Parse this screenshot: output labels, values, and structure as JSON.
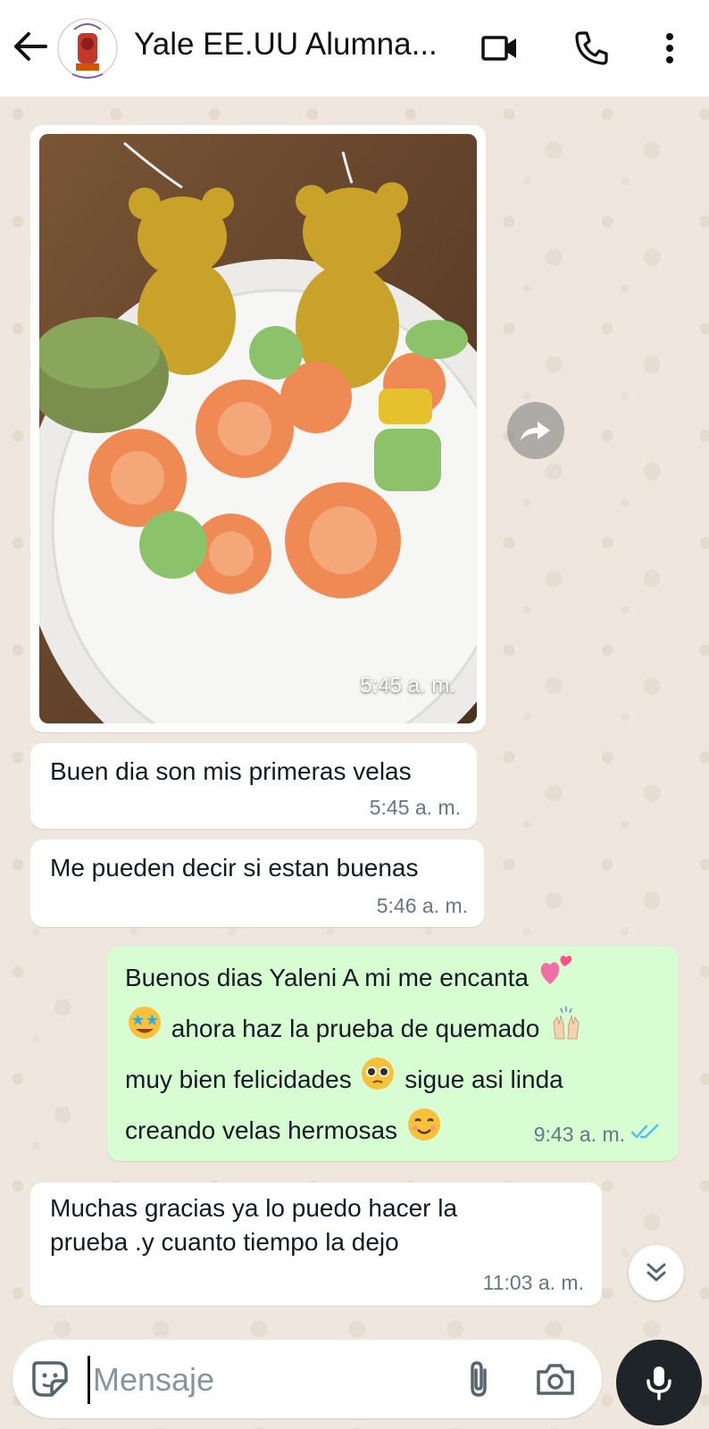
{
  "header": {
    "title": "Yale EE.UU Alumna...",
    "avatar_icon": "group-avatar"
  },
  "messages": [
    {
      "type": "image",
      "direction": "incoming",
      "time": "5:45 a. m."
    },
    {
      "type": "text",
      "direction": "incoming",
      "text": "Buen dia son mis primeras velas",
      "time": "5:45 a. m."
    },
    {
      "type": "text",
      "direction": "incoming",
      "text": "Me pueden decir si estan buenas",
      "time": "5:46 a. m."
    },
    {
      "type": "text",
      "direction": "outgoing",
      "read": true,
      "time": "9:43 a. m.",
      "lines": [
        "Buenos dias Yaleni A mi me encanta",
        "ahora haz la prueba de quemado",
        "muy bien felicidades",
        "sigue asi linda",
        "creando velas hermosas"
      ]
    },
    {
      "type": "text",
      "direction": "incoming",
      "time": "11:03 a. m.",
      "lines": [
        "Muchas gracias ya lo puedo hacer la",
        "prueba .y cuanto tiempo la dejo"
      ]
    }
  ],
  "input": {
    "placeholder": "Mensaje",
    "value": ""
  },
  "colors": {
    "incoming_bubble": "#ffffff",
    "outgoing_bubble": "#d9fdd3",
    "read_ticks": "#53bdeb",
    "mic_button": "#1f2428"
  }
}
